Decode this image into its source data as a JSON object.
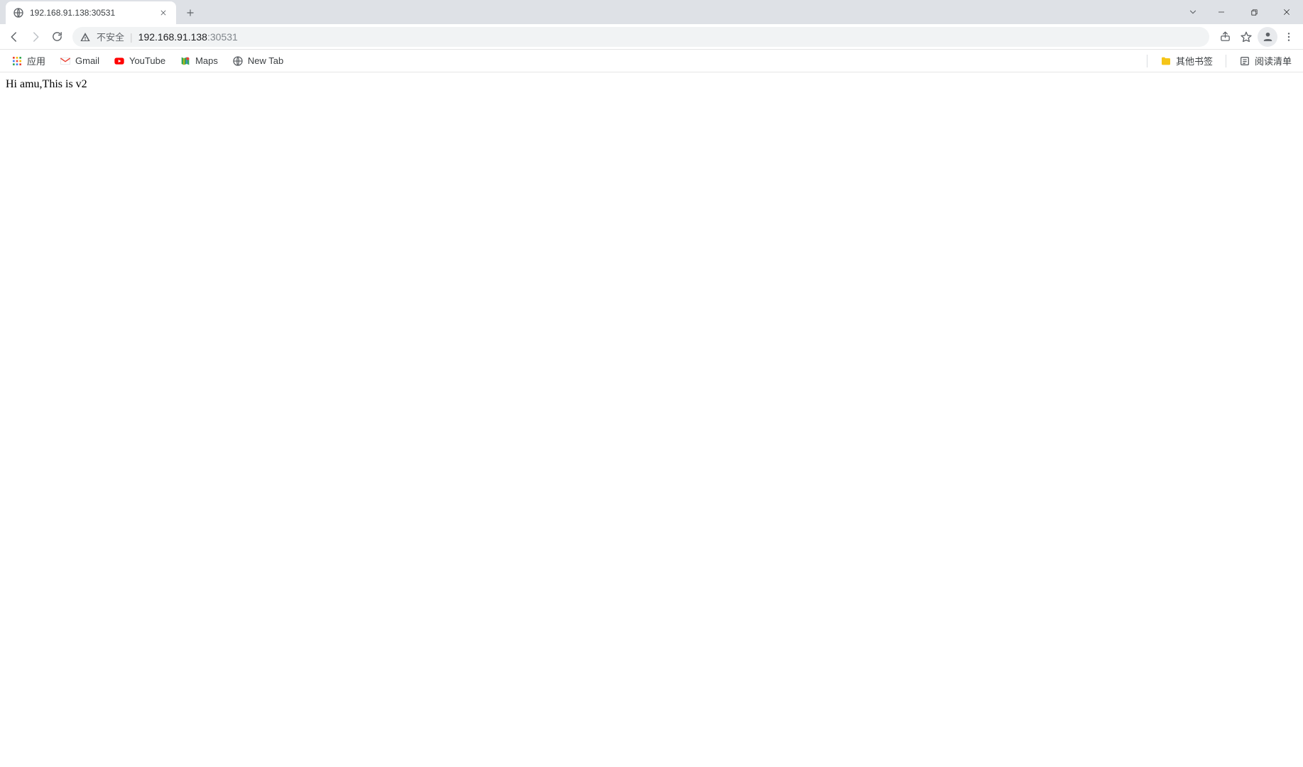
{
  "tab": {
    "title": "192.168.91.138:30531"
  },
  "toolbar": {
    "not_secure_label": "不安全",
    "url_host": "192.168.91.138",
    "url_port": ":30531"
  },
  "bookmarks": {
    "apps": "应用",
    "gmail": "Gmail",
    "youtube": "YouTube",
    "maps": "Maps",
    "newtab": "New Tab",
    "other": "其他书签",
    "reading": "阅读清单"
  },
  "page": {
    "body_text": "Hi amu,This is v2"
  }
}
